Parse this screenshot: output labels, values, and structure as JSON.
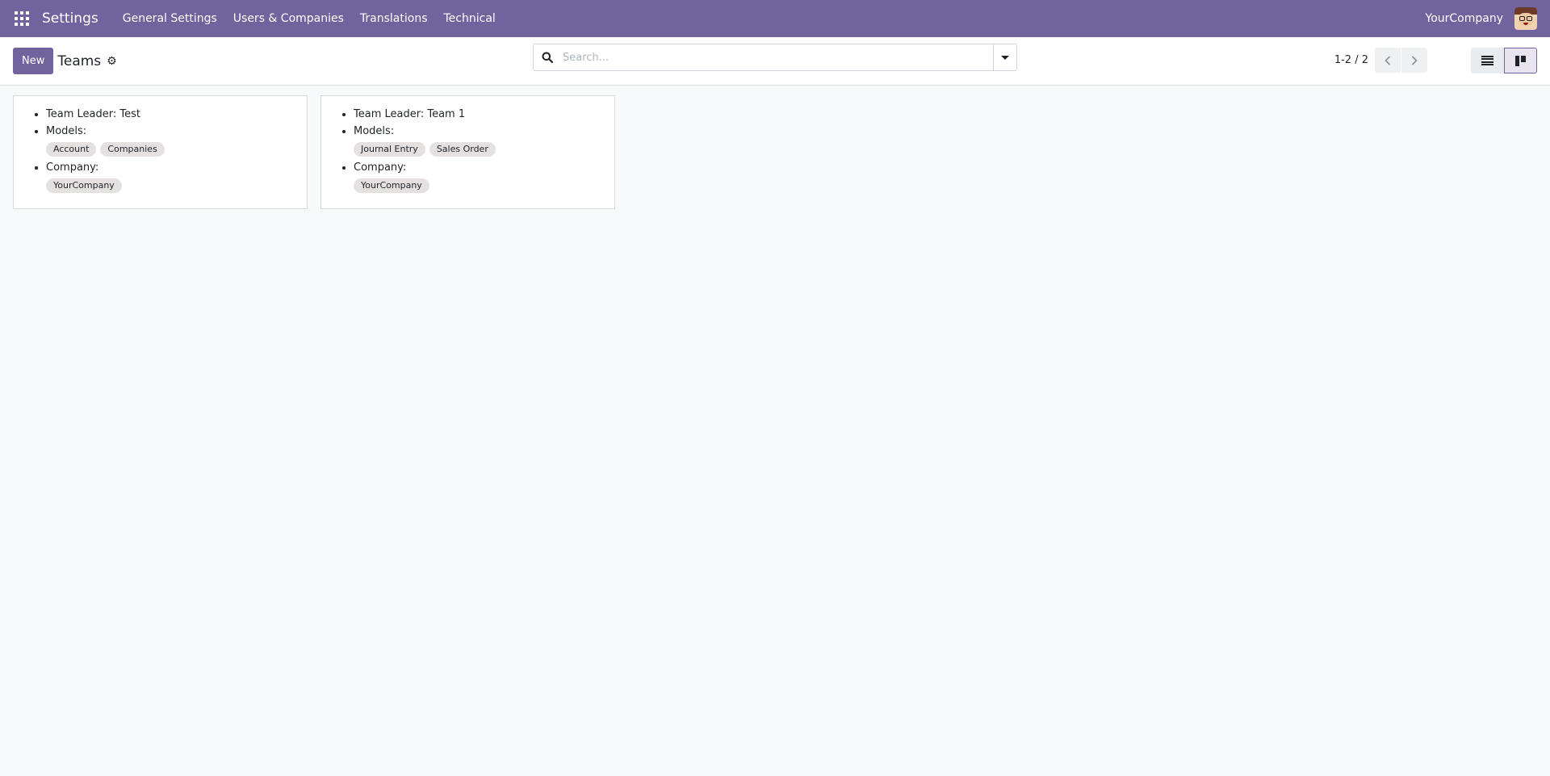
{
  "navbar": {
    "app_name": "Settings",
    "menu": [
      "General Settings",
      "Users & Companies",
      "Translations",
      "Technical"
    ],
    "company": "YourCompany"
  },
  "control_panel": {
    "new_label": "New",
    "title": "Teams",
    "search_placeholder": "Search...",
    "pager_value": "1-2 / 2"
  },
  "cards": [
    {
      "leader_text": "Team Leader: Test",
      "models_label": "Models:",
      "models": [
        "Account",
        "Companies"
      ],
      "company_label": "Company:",
      "companies": [
        "YourCompany"
      ]
    },
    {
      "leader_text": "Team Leader: Team 1",
      "models_label": "Models:",
      "models": [
        "Journal Entry",
        "Sales Order"
      ],
      "company_label": "Company:",
      "companies": [
        "YourCompany"
      ]
    }
  ],
  "colors": {
    "brand": "#71639e",
    "background": "#f8f9fa",
    "tag": "#e5e1e1"
  },
  "icons": {
    "apps": "apps-grid-icon",
    "gear": "gear-icon",
    "search": "search-icon",
    "caret": "caret-down-icon",
    "prev": "chevron-left-icon",
    "next": "chevron-right-icon",
    "list_view": "list-view-icon",
    "kanban_view": "kanban-view-icon"
  }
}
